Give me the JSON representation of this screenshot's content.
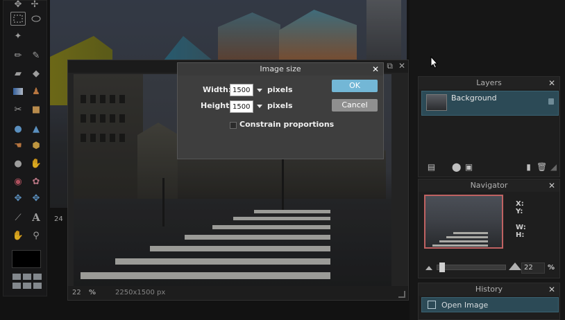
{
  "document": {
    "zoom": "22",
    "zoom_unit": "%",
    "dimensions": "2250x1500 px",
    "side_number": "24"
  },
  "tools": {
    "foreground_color": "#000000"
  },
  "dialog": {
    "title": "Image size",
    "width_label": "Width:",
    "width_value": "1500",
    "width_unit": "pixels",
    "height_label": "Height:",
    "height_value": "1500",
    "height_unit": "pixels",
    "ok_label": "OK",
    "cancel_label": "Cancel",
    "constrain_label": "Constrain proportions",
    "constrain_checked": false
  },
  "layers_panel": {
    "title": "Layers",
    "layers": [
      {
        "name": "Background",
        "locked": true
      }
    ]
  },
  "navigator_panel": {
    "title": "Navigator",
    "x_label": "X:",
    "y_label": "Y:",
    "w_label": "W:",
    "h_label": "H:",
    "zoom_value": "22",
    "zoom_unit": "%"
  },
  "history_panel": {
    "title": "History",
    "items": [
      {
        "label": "Open Image"
      }
    ]
  },
  "colors": {
    "accent": "#73b7d6",
    "selection_row": "#2c4a56"
  }
}
